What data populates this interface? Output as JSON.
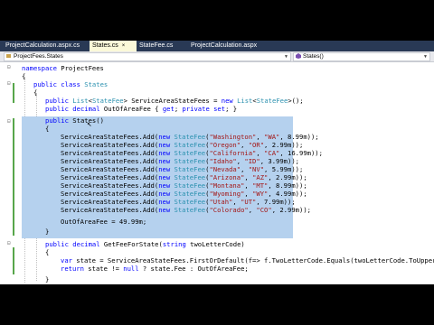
{
  "tabs": [
    {
      "label": "ProjectCalculation.aspx.cs",
      "active": false,
      "close": ""
    },
    {
      "label": "States.cs",
      "active": true,
      "close": "×"
    },
    {
      "label": "StateFee.cs",
      "active": false,
      "close": ""
    },
    {
      "label": "ProjectCalculation.aspx",
      "active": false,
      "close": ""
    }
  ],
  "nav": {
    "type_combo": "ProjectFees.States",
    "member_combo": "States()"
  },
  "code": {
    "l1": [
      "namespace",
      " ProjectFees"
    ],
    "l2": "{",
    "l3": [
      "public class",
      " States"
    ],
    "l4": "{",
    "l5": [
      "public ",
      "List",
      "<",
      "StateFee",
      "> ServiceAreaStateFees = ",
      "new ",
      "List",
      "<",
      "StateFee",
      ">();"
    ],
    "l6": [
      "public decimal",
      " OutOfAreaFee { ",
      "get",
      "; ",
      "private set",
      "; }"
    ],
    "l7": [
      "public",
      " States()"
    ],
    "l8": "{",
    "fees": [
      [
        "Washington",
        "WA",
        "8.99m"
      ],
      [
        "Oregon",
        "OR",
        "2.99m"
      ],
      [
        "California",
        "CA",
        "16.99m"
      ],
      [
        "Idaho",
        "ID",
        "3.99m"
      ],
      [
        "Nevada",
        "NV",
        "5.99m"
      ],
      [
        "Arizona",
        "AZ",
        "2.99m"
      ],
      [
        "Montana",
        "MT",
        "8.99m"
      ],
      [
        "Wyoming",
        "WY",
        "4.99m"
      ],
      [
        "Utah",
        "UT",
        "7.99m"
      ],
      [
        "Colorado",
        "CO",
        "2.99m"
      ]
    ],
    "fee_prefix": "ServiceAreaStateFees.Add(",
    "fee_new": "new ",
    "fee_type": "StateFee",
    "out_of_area": "OutOfAreaFee = 49.99m;",
    "l_close1": "}",
    "l_method": [
      "public decimal",
      " GetFeeForState(",
      "string",
      " twoLetterCode)"
    ],
    "l_open2": "{",
    "l_var": [
      "var",
      " state = ServiceAreaStateFees.FirstOrDefault(f=> f.TwoLetterCode.Equals(twoLetterCode.ToUpper()));"
    ],
    "l_return": [
      "return",
      " state != ",
      "null",
      " ? state.Fee : OutOfAreaFee;"
    ],
    "l_close2": "}"
  },
  "colors": {
    "keyword": "#0000ff",
    "type": "#2b91af",
    "string": "#a31515",
    "selection": "#b5d1ee",
    "tab_bg": "#293955",
    "active_tab": "#fbf9d9"
  },
  "icons": {
    "collapse": "⊟"
  }
}
